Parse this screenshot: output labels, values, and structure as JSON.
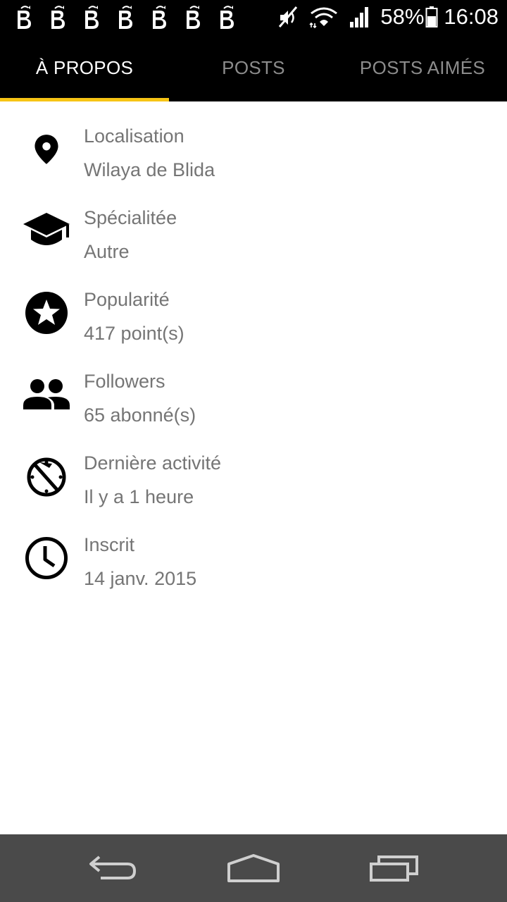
{
  "status_bar": {
    "notification_icons": [
      "app-b-icon",
      "app-b-icon",
      "app-b-icon",
      "app-b-icon",
      "app-b-icon",
      "app-b-icon",
      "app-b-icon"
    ],
    "battery": "58%",
    "time": "16:08"
  },
  "tabs": [
    {
      "label": "À PROPOS",
      "active": true
    },
    {
      "label": "POSTS",
      "active": false
    },
    {
      "label": "POSTS AIMÉS",
      "active": false
    }
  ],
  "accent_color": "#f6c415",
  "info": [
    {
      "icon": "location-pin-icon",
      "label": "Localisation",
      "value": "Wilaya de Blida"
    },
    {
      "icon": "graduation-cap-icon",
      "label": "Spécialitée",
      "value": "Autre"
    },
    {
      "icon": "star-circle-icon",
      "label": "Popularité",
      "value": "417 point(s)"
    },
    {
      "icon": "people-icon",
      "label": "Followers",
      "value": "65 abonné(s)"
    },
    {
      "icon": "timer-off-icon",
      "label": "Dernière activité",
      "value": "Il y a 1 heure"
    },
    {
      "icon": "clock-icon",
      "label": "Inscrit",
      "value": "14 janv. 2015"
    }
  ],
  "nav_bar": {
    "buttons": [
      "back-icon",
      "home-icon",
      "recent-apps-icon"
    ]
  }
}
